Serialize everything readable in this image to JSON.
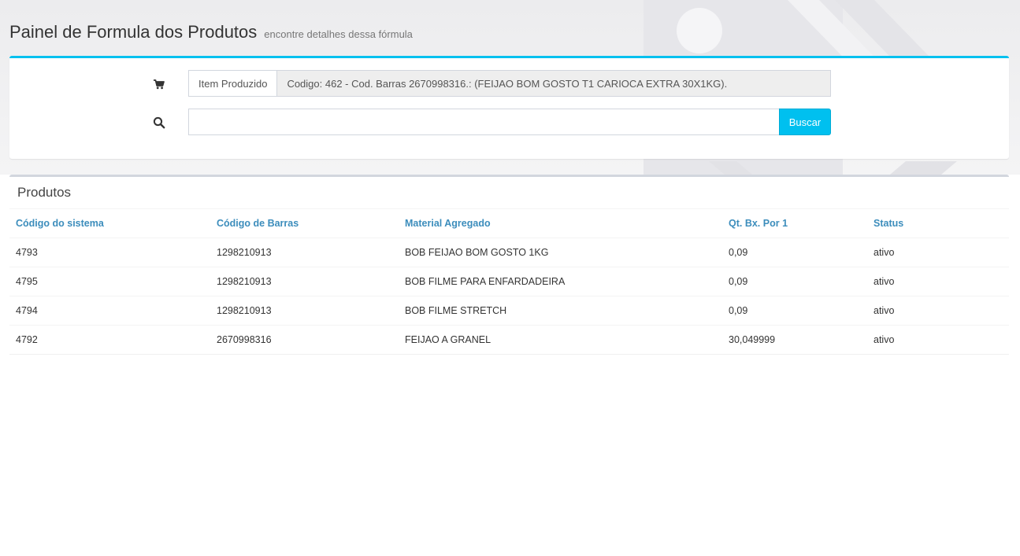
{
  "header": {
    "title": "Painel de Formula dos Produtos",
    "subtitle": "encontre detalhes dessa fórmula"
  },
  "search_box": {
    "item_icon": "shopping-cart-icon",
    "search_icon": "search-icon",
    "item_label": "Item Produzido",
    "item_value": "Codigo: 462 - Cod. Barras 2670998316.: (FEIJAO BOM GOSTO T1 CARIOCA EXTRA 30X1KG).",
    "search_placeholder": "",
    "search_value": "",
    "button_label": "Buscar"
  },
  "products": {
    "title": "Produtos",
    "columns": [
      "Código do sistema",
      "Código de Barras",
      "Material Agregado",
      "Qt. Bx. Por 1",
      "Status"
    ],
    "rows": [
      [
        "4793",
        "1298210913",
        "BOB FEIJAO BOM GOSTO 1KG",
        "0,09",
        "ativo"
      ],
      [
        "4795",
        "1298210913",
        "BOB FILME PARA ENFARDADEIRA",
        "0,09",
        "ativo"
      ],
      [
        "4794",
        "1298210913",
        "BOB FILME STRETCH",
        "0,09",
        "ativo"
      ],
      [
        "4792",
        "2670998316",
        "FEIJAO A GRANEL",
        "30,049999",
        "ativo"
      ]
    ]
  },
  "colors": {
    "accent": "#00c0ef",
    "link": "#3c8dbc"
  }
}
